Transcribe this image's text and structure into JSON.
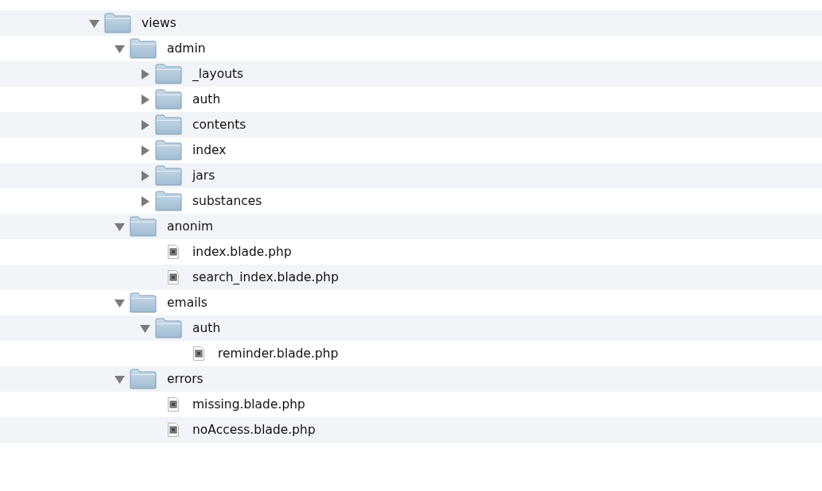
{
  "tree": [
    {
      "kind": "folder",
      "name": "views",
      "expanded": true,
      "children": [
        {
          "kind": "folder",
          "name": "admin",
          "expanded": true,
          "children": [
            {
              "kind": "folder",
              "name": "_layouts",
              "expanded": false
            },
            {
              "kind": "folder",
              "name": "auth",
              "expanded": false
            },
            {
              "kind": "folder",
              "name": "contents",
              "expanded": false
            },
            {
              "kind": "folder",
              "name": "index",
              "expanded": false
            },
            {
              "kind": "folder",
              "name": "jars",
              "expanded": false
            },
            {
              "kind": "folder",
              "name": "substances",
              "expanded": false
            }
          ]
        },
        {
          "kind": "folder",
          "name": "anonim",
          "expanded": true,
          "children": [
            {
              "kind": "file",
              "name": "index.blade.php"
            },
            {
              "kind": "file",
              "name": "search_index.blade.php"
            }
          ]
        },
        {
          "kind": "folder",
          "name": "emails",
          "expanded": true,
          "children": [
            {
              "kind": "folder",
              "name": "auth",
              "expanded": true,
              "children": [
                {
                  "kind": "file",
                  "name": "reminder.blade.php"
                }
              ]
            }
          ]
        },
        {
          "kind": "folder",
          "name": "errors",
          "expanded": true,
          "children": [
            {
              "kind": "file",
              "name": "missing.blade.php"
            },
            {
              "kind": "file",
              "name": "noAccess.blade.php"
            }
          ]
        }
      ]
    }
  ]
}
